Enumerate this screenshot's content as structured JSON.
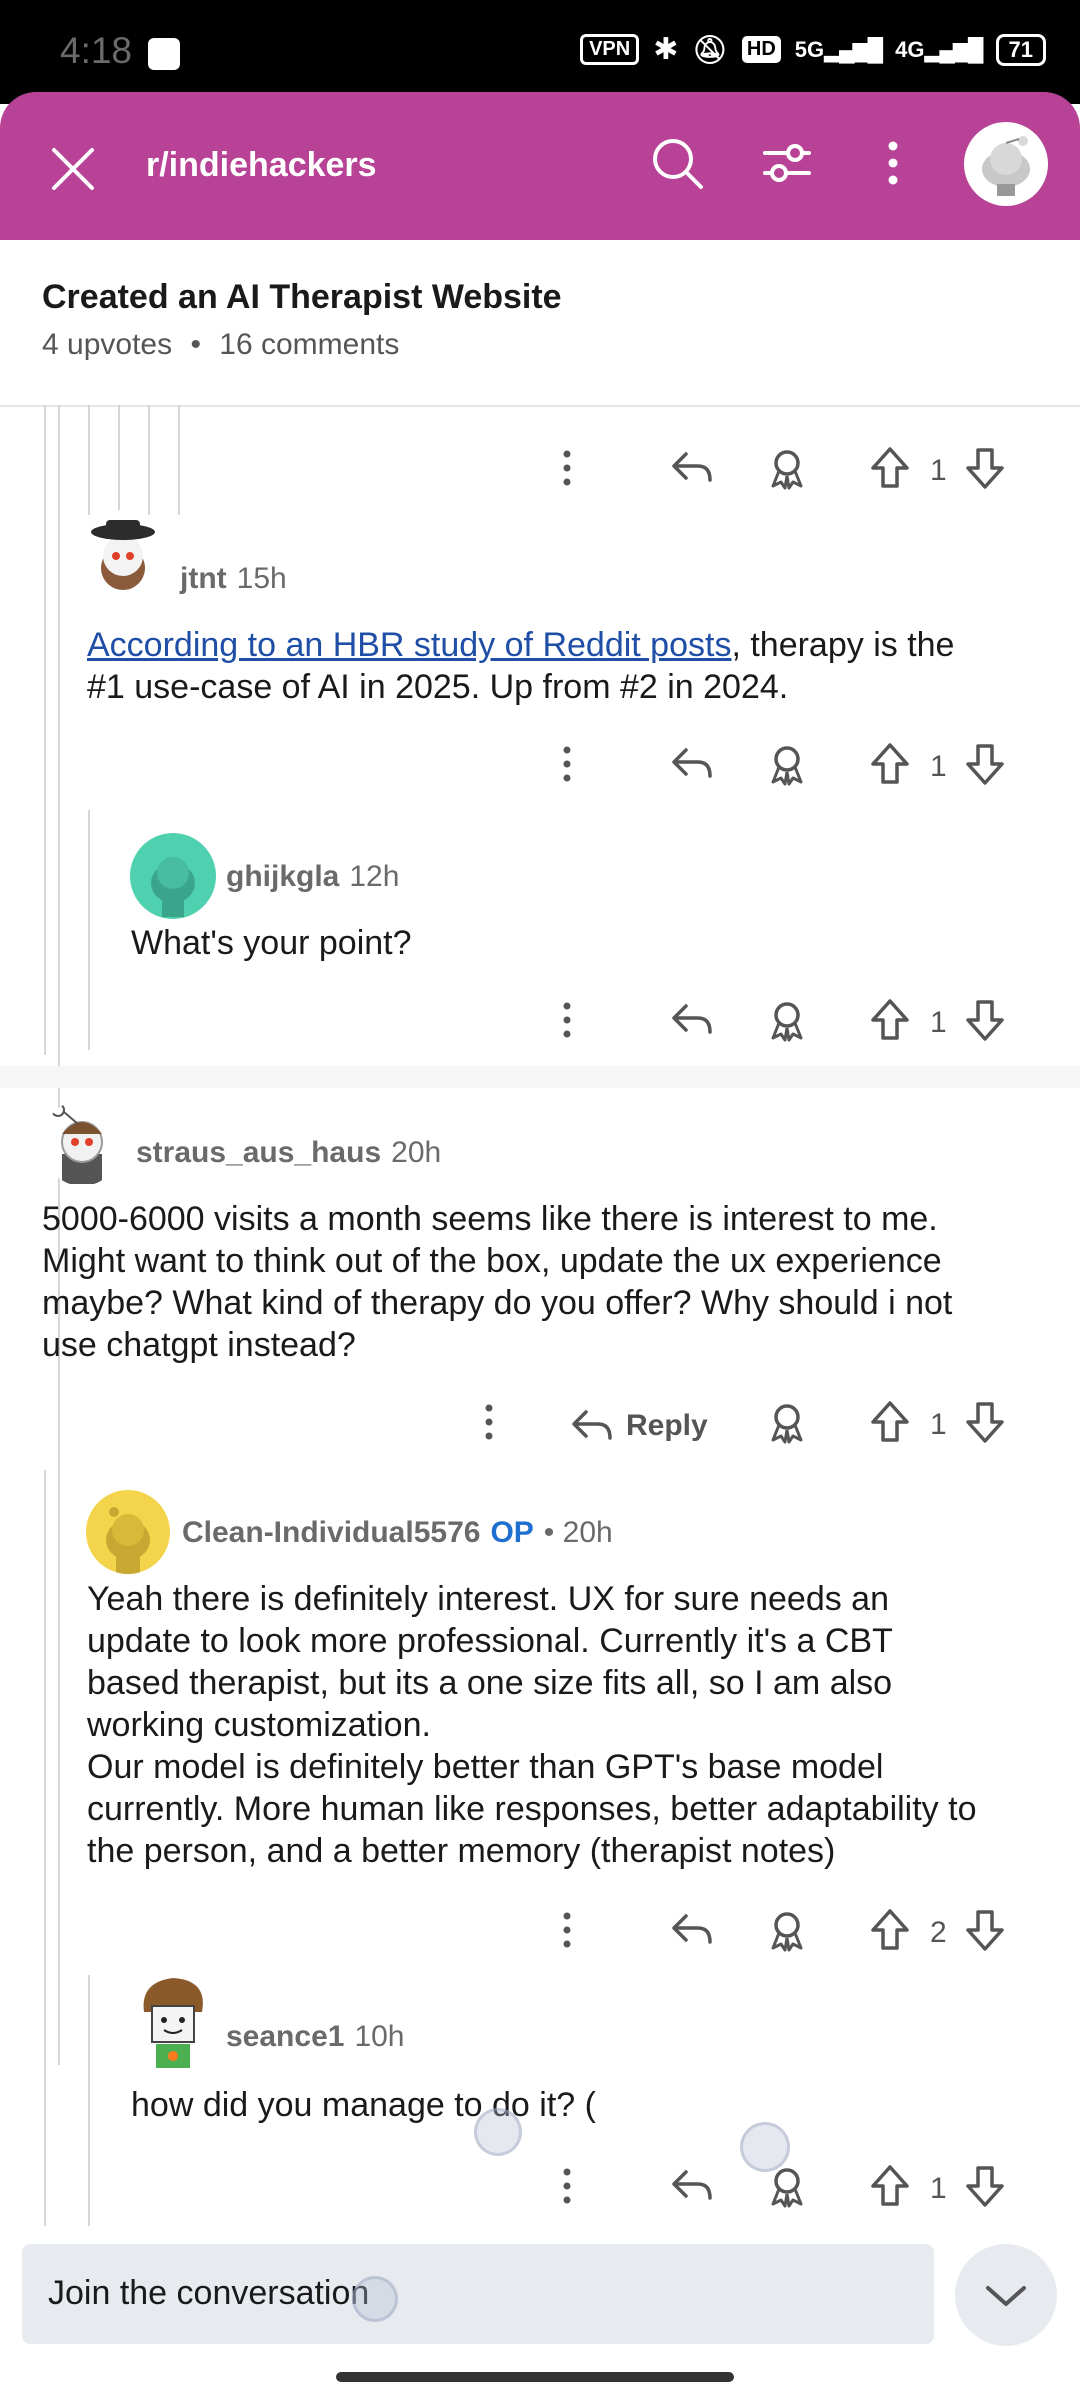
{
  "status_bar": {
    "time": "4:18",
    "vpn": "VPN",
    "hd": "HD",
    "net1": "5G",
    "net2": "4G",
    "battery": "71"
  },
  "header": {
    "subreddit": "r/indiehackers",
    "icons": [
      "close-icon",
      "search-icon",
      "filter-icon",
      "more-vert-icon",
      "avatar"
    ]
  },
  "post": {
    "title": "Created an AI Therapist Website",
    "upvotes": "4 upvotes",
    "dot": "•",
    "comments": "16 comments"
  },
  "comments": [
    {
      "id": "c0",
      "partial": true,
      "votes": "1"
    },
    {
      "id": "c1",
      "user": "jtnt",
      "time": "15h",
      "link_text": "According to an HBR study of Reddit posts",
      "text_rest": ", therapy is the",
      "text_line2": "#1 use-case of AI in 2025. Up from #2 in 2024.",
      "votes": "1"
    },
    {
      "id": "c2",
      "user": "ghijkgla",
      "time": "12h",
      "text": "What's your point?",
      "votes": "1"
    },
    {
      "id": "c3",
      "user": "straus_aus_haus",
      "time": "20h",
      "lines": [
        "5000-6000 visits a month seems like there is interest to me.",
        "Might want to think out of the box, update the ux experience",
        "maybe? What kind of therapy do you offer? Why should i not",
        "use chatgpt instead?"
      ],
      "reply_label": "Reply",
      "votes": "1"
    },
    {
      "id": "c4",
      "user": "Clean-Individual5576",
      "op": "OP",
      "time": "• 20h",
      "lines": [
        "Yeah there is definitely interest. UX for sure needs an",
        "update to look more professional. Currently it's a CBT",
        "based therapist, but its a one size fits all, so I am also",
        "working customization.",
        "Our model is definitely better than GPT's base model",
        "currently. More human like responses, better adaptability to",
        "the person, and a better memory (therapist notes)"
      ],
      "votes": "2"
    },
    {
      "id": "c5",
      "user": "seance1",
      "time": "10h",
      "text": "how did you manage to do it? (",
      "votes": "1"
    }
  ],
  "composer": {
    "placeholder": "Join the conversation"
  },
  "colors": {
    "header_bg": "#b84396",
    "link": "#1f4ea6",
    "op": "#1f6fd1"
  }
}
